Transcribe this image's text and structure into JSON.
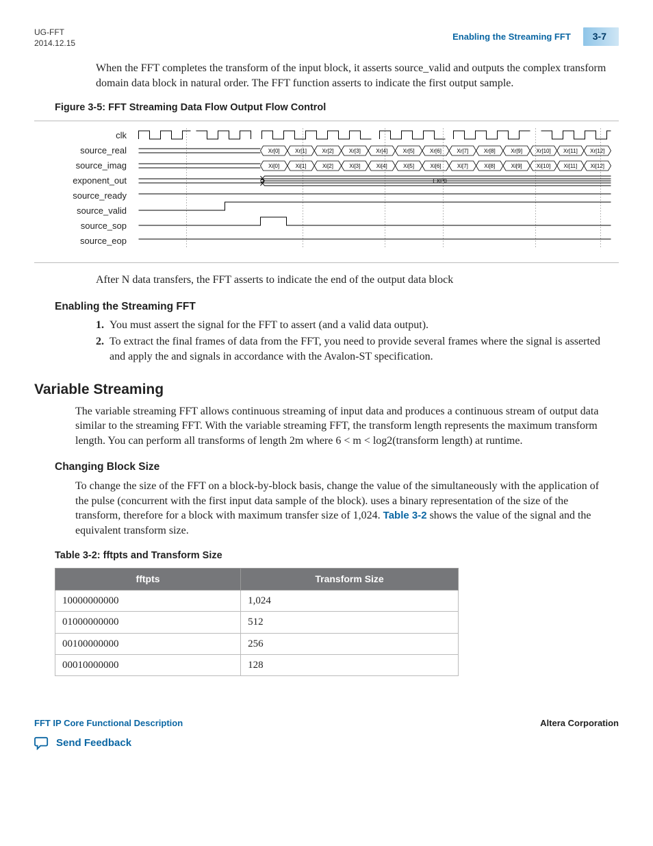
{
  "header": {
    "doc_id": "UG-FFT",
    "date": "2014.12.15",
    "section_title": "Enabling the Streaming FFT",
    "page_num": "3-7"
  },
  "intro_para": "When the FFT completes the transform of the input block, it asserts source_valid and outputs the complex transform domain data block in natural order. The FFT function asserts                      to indicate the first output sample.",
  "figure": {
    "title": "Figure 3-5: FFT Streaming Data Flow Output Flow Control",
    "signals": [
      "clk",
      "source_real",
      "source_imag",
      "exponent_out",
      "source_ready",
      "source_valid",
      "source_sop",
      "source_eop"
    ],
    "real_labels": [
      "Xr[0]",
      "Xr[1]",
      "Xr[2]",
      "Xr[3]",
      "Xr[4]",
      "Xr[5]",
      "Xr[6]",
      "Xr[7]",
      "Xr[8]",
      "Xr[9]",
      "Xr[10]",
      "Xr[11]",
      "Xr[12]"
    ],
    "imag_labels": [
      "Xi[0]",
      "Xi[1]",
      "Xi[2]",
      "Xi[3]",
      "Xi[4]",
      "Xi[5]",
      "Xi[6]",
      "Xi[7]",
      "Xi[8]",
      "Xi[9]",
      "Xi[10]",
      "Xi[11]",
      "Xi[12]"
    ],
    "exp_label": "EXP0"
  },
  "after_fig": "After N data transfers, the FFT asserts                      to indicate the end of the output data block",
  "enabling": {
    "heading": "Enabling the Streaming FFT",
    "step1": "You must assert the                      signal for the FFT to assert                      (and a valid data output).",
    "step2": "To extract the final frames of data from the FFT, you need to provide several frames where the                      signal is asserted and apply the                      and                      signals in accordance with the Avalon-ST specification."
  },
  "variable": {
    "heading": "Variable Streaming",
    "para": "The variable streaming FFT allows continuous streaming of input data and produces a continuous stream of output data similar to the streaming FFT. With the variable streaming FFT, the transform length represents the maximum transform length. You can perform all transforms of length 2m where 6 < m < log2(transform length) at runtime."
  },
  "changing": {
    "heading": "Changing Block Size",
    "para_a": "To change the size of the FFT on a block-by-block basis, change the value of the               simultaneously with the application of the               pulse (concurrent with the first input data sample of the block).               uses a binary representation of the size of the transform, therefore for a block with maximum transfer size of 1,024. ",
    "para_b_pre": "Table 3-2",
    "para_b_post": " shows the value of the               signal and the equivalent transform size."
  },
  "table": {
    "title": "Table 3-2: fftpts and Transform Size",
    "col1": "fftpts",
    "col2": "Transform Size",
    "rows": [
      {
        "a": "10000000000",
        "b": "1,024"
      },
      {
        "a": "01000000000",
        "b": "512"
      },
      {
        "a": "00100000000",
        "b": "256"
      },
      {
        "a": "00010000000",
        "b": "128"
      }
    ]
  },
  "footer": {
    "left": "FFT IP Core Functional Description",
    "right": "Altera Corporation",
    "feedback": "Send Feedback"
  }
}
